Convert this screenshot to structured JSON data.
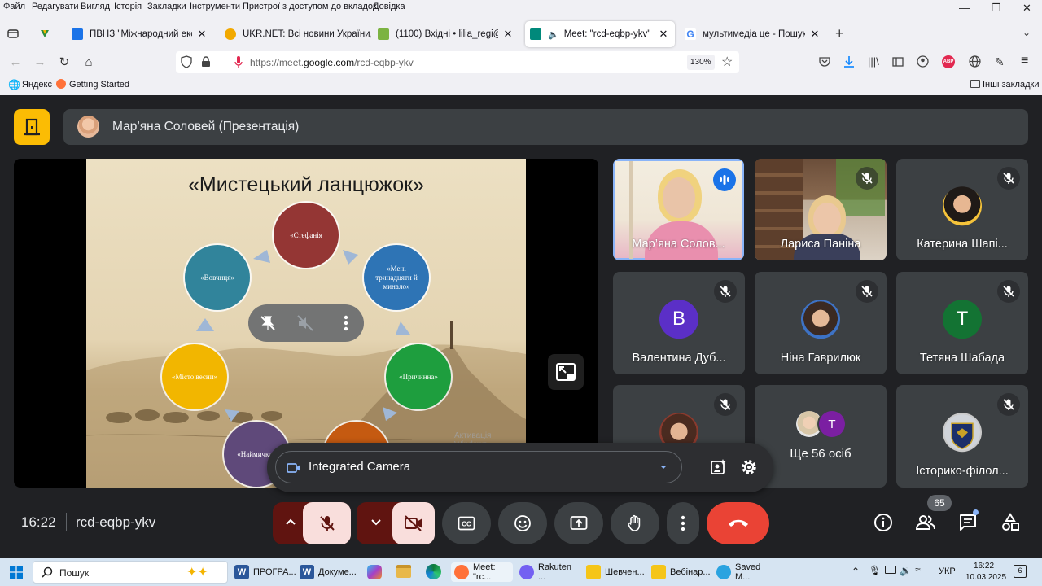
{
  "browser": {
    "menu": [
      "Файл",
      "Редагувати",
      "Вигляд",
      "Історія",
      "Закладки",
      "Інструменти",
      "Пристрої з доступом до вкладок",
      "Довідка"
    ],
    "tabs": [
      {
        "label": "ПВНЗ \"Міжнародний економі...",
        "color": "#1a73e8"
      },
      {
        "label": "UKR.NET: Всі новини України, ...",
        "color": "#f2a900"
      },
      {
        "label": "(1100) Вхідні • lilia_regi@ukr.ne...",
        "color": "#7cb342"
      },
      {
        "label": "Meet: \"rcd-eqbp-ykv\"",
        "color": "#00897b"
      },
      {
        "label": "мультимедіа це - Пошук Goog...",
        "color": "#4285f4"
      }
    ],
    "url_prefix": "https://meet.",
    "url_domain": "google.com",
    "url_path": "/rcd-eqbp-ykv",
    "zoom": "130%",
    "bookmarks": [
      "Яндекс",
      "Getting Started"
    ],
    "other_bookmarks": "Інші закладки",
    "abp": "ABP"
  },
  "meet": {
    "presenter_label": "Мар’яна Соловей (Презентація)",
    "slide": {
      "title": "«Мистецький ланцюжок»",
      "circles": [
        "«Стефанія",
        "«Мені тринадцяти й минало»",
        "«Причинна»",
        "«Наймичка»",
        "«Місто весни»",
        "«Вовчиця»"
      ],
      "watermark": "Активація Windows"
    },
    "participants": [
      {
        "name": "Мар’яна Солов...",
        "speaking": true
      },
      {
        "name": "Лариса Паніна"
      },
      {
        "name": "Катерина Шапі..."
      },
      {
        "name": "Валентина Дуб...",
        "initial": "B",
        "avatar_color": "#5b2fc7"
      },
      {
        "name": "Ніна Гаврилюк"
      },
      {
        "name": "Тетяна Шабада",
        "initial": "T",
        "avatar_color": "#137333"
      },
      {
        "name": ""
      },
      {
        "name": "Ще 56 осіб",
        "initial": "T",
        "avatar_color": "#7b1fa2"
      },
      {
        "name": "Історико-філол..."
      }
    ],
    "camera_menu": {
      "label": "Integrated Camera"
    },
    "time": "16:22",
    "meeting_code": "rcd-eqbp-ykv",
    "people_count": "65",
    "colors": {
      "end_call": "#ea4335",
      "muted_bg": "#f9dedc",
      "muted_dark": "#601410",
      "accent": "#8ab4f8"
    }
  },
  "taskbar": {
    "search": "Пошук",
    "apps": [
      {
        "label": "ПРОГРА...",
        "color": "#2b579a",
        "glyph": "W"
      },
      {
        "label": "Докуме...",
        "color": "#2b579a",
        "glyph": "W"
      },
      {
        "label": "Meet: \"rc...",
        "color": "#ff7139",
        "glyph": ""
      },
      {
        "label": "Rakuten ...",
        "color": "#7360f2",
        "glyph": ""
      },
      {
        "label": "Шевчен...",
        "color": "#f5c518",
        "glyph": ""
      },
      {
        "label": "Вебінар...",
        "color": "#f5c518",
        "glyph": ""
      },
      {
        "label": "Saved M...",
        "color": "#2aa3e0",
        "glyph": ""
      }
    ],
    "lang": "УКР",
    "clock_time": "16:22",
    "clock_date": "10.03.2025",
    "notif": "6"
  }
}
